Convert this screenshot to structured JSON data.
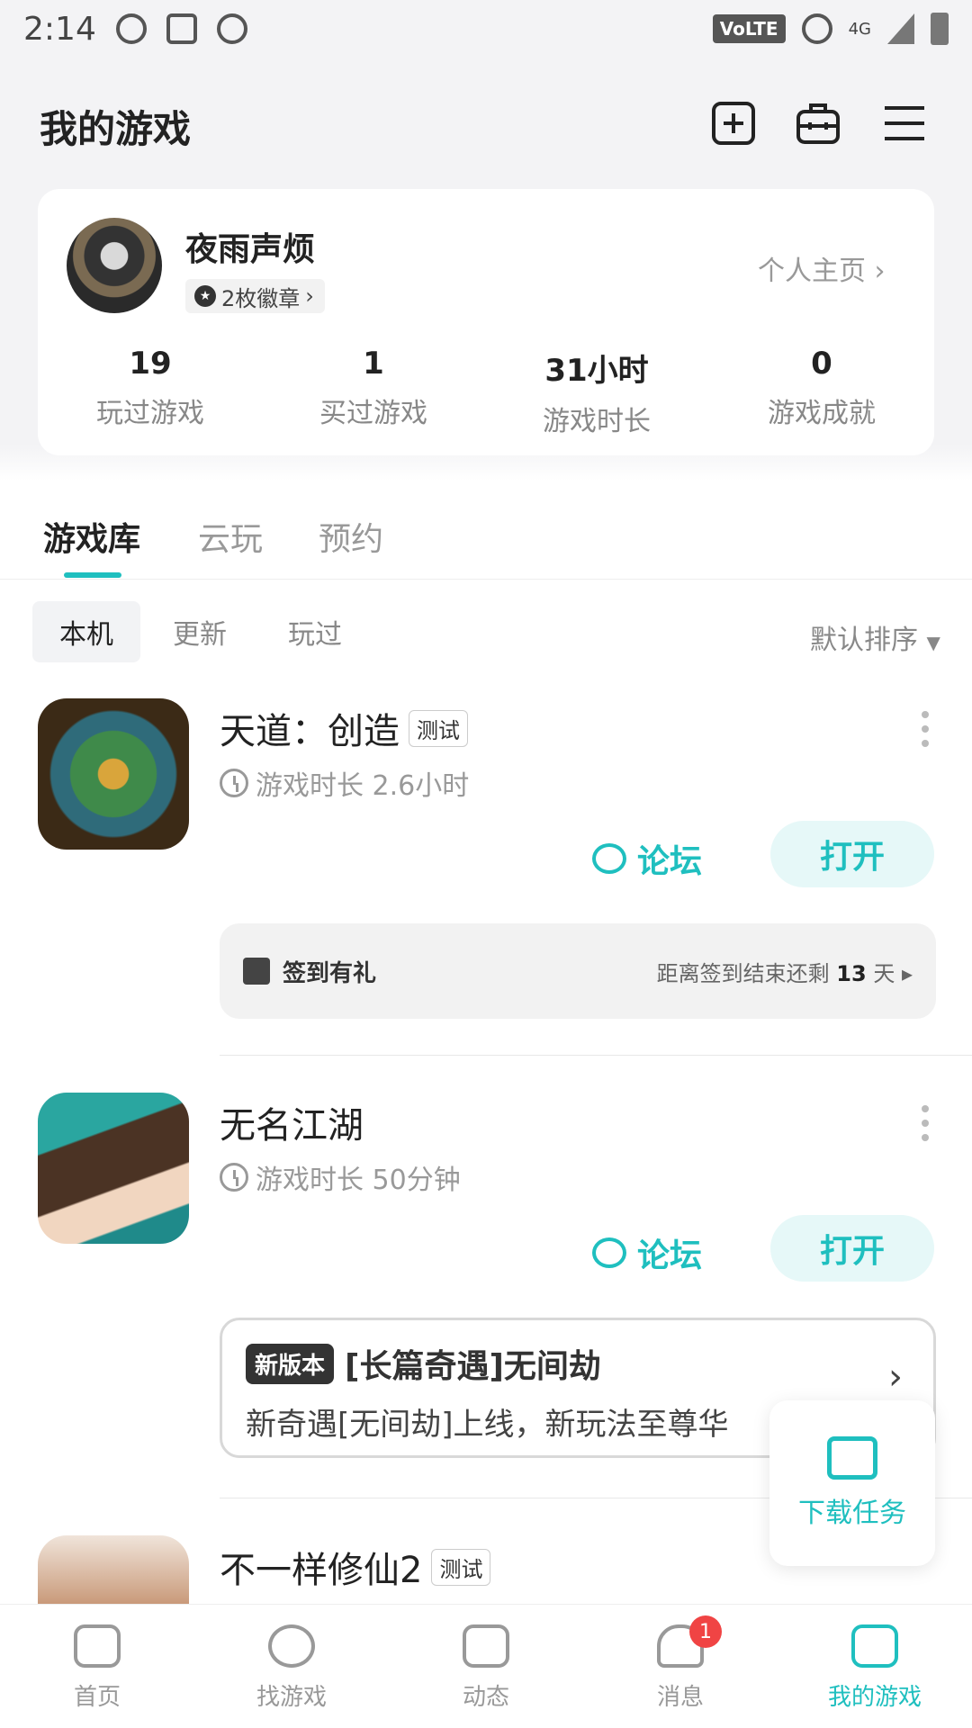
{
  "status": {
    "time": "2:14",
    "volte": "VoLTE",
    "network": "4G"
  },
  "page": {
    "title": "我的游戏"
  },
  "profile": {
    "name": "夜雨声烦",
    "badges": "2枚徽章",
    "homepage": "个人主页",
    "stats": [
      {
        "value": "19",
        "label": "玩过游戏"
      },
      {
        "value": "1",
        "label": "买过游戏"
      },
      {
        "value": "31小时",
        "label": "游戏时长"
      },
      {
        "value": "0",
        "label": "游戏成就"
      }
    ]
  },
  "tabs": [
    {
      "label": "游戏库"
    },
    {
      "label": "云玩"
    },
    {
      "label": "预约"
    }
  ],
  "subtabs": [
    {
      "label": "本机"
    },
    {
      "label": "更新"
    },
    {
      "label": "玩过"
    }
  ],
  "sort": "默认排序",
  "games": [
    {
      "name": "天道：创造",
      "tag": "测试",
      "duration": "游戏时长 2.6小时",
      "forum": "论坛",
      "open": "打开"
    },
    {
      "name": "无名江湖",
      "tag": "",
      "duration": "游戏时长 50分钟",
      "forum": "论坛",
      "open": "打开"
    },
    {
      "name": "不一样修仙2",
      "tag": "测试"
    }
  ],
  "signin": {
    "label": "签到有礼",
    "prefix": "距离签到结束还剩",
    "days": "13",
    "suffix": "天"
  },
  "news": {
    "badge": "新版本",
    "title": "[长篇奇遇]无间劫",
    "body": "新奇遇[无间劫]上线，新玩法至尊华"
  },
  "download": {
    "label": "下载任务"
  },
  "nav": [
    {
      "label": "首页"
    },
    {
      "label": "找游戏"
    },
    {
      "label": "动态"
    },
    {
      "label": "消息",
      "badge": "1"
    },
    {
      "label": "我的游戏"
    }
  ],
  "colors": {
    "accent": "#1fbfbf",
    "badge": "#f04444"
  }
}
